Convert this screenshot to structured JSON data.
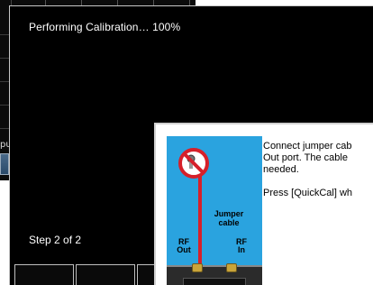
{
  "calibration": {
    "status": "Performing Calibration… 100%",
    "step": "Step 2 of 2"
  },
  "background_window": {
    "partial_label": "pu"
  },
  "instructions": {
    "line1": "Connect jumper cab",
    "line2": "Out port.  The cable",
    "line3": "needed.",
    "press": "Press [QuickCal] wh"
  },
  "diagram": {
    "cable_label": "Jumper cable",
    "rf_out": "RF Out",
    "rf_in": "RF In",
    "warning_icon": "no-symbol-icon",
    "colors": {
      "panel_background": "#2aa3df",
      "cable": "#d6202a",
      "connector": "#c9a43a"
    }
  },
  "softkeys": {
    "count": 6
  }
}
